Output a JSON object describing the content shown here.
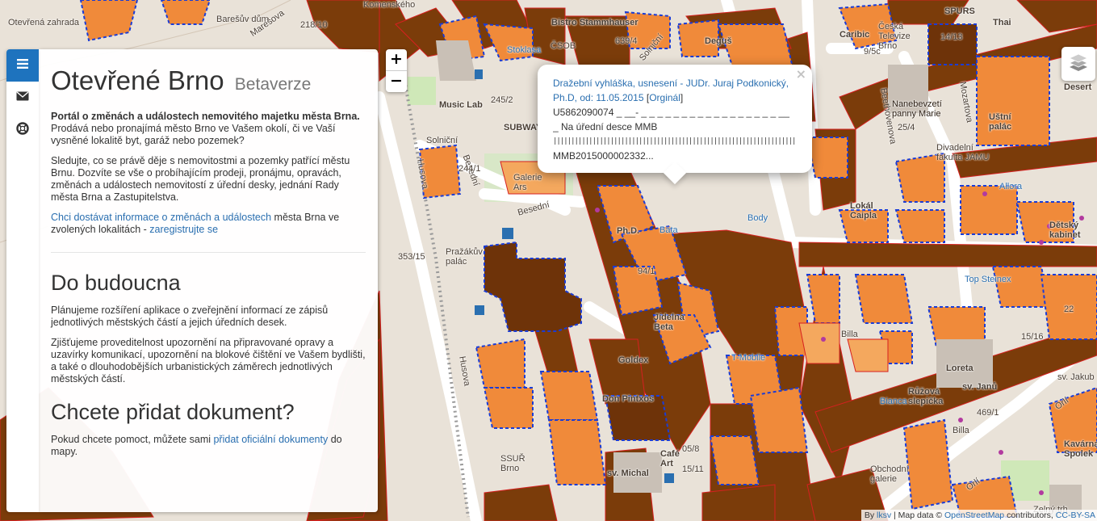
{
  "app": {
    "title": "Otevřené Brno",
    "subtitle": "Betaverze"
  },
  "rail": {
    "items": [
      {
        "icon": "menu-icon",
        "active": true
      },
      {
        "icon": "envelope-icon",
        "active": false
      },
      {
        "icon": "lifebuoy-icon",
        "active": false
      }
    ]
  },
  "intro": {
    "lead": "Portál o změnách a událostech nemovitého majetku města Brna.",
    "question": "Prodává nebo pronajímá město Brno ve Vašem okolí, či ve Vaší vysněné lokalitě byt, garáž nebo pozemek?",
    "paragraph": "Sledujte, co se právě děje s nemovitostmi a pozemky patřící městu Brnu. Dozvíte se vše o probíhajícím prodeji, pronájmu, opravách, změnách a událostech nemovitostí z úřední desky, jednání Rady města Brna a Zastupitelstva.",
    "subscribe_link": "Chci dostávat informace o změnách a událostech",
    "subscribe_mid": " města Brna ve zvolených lokalitách - ",
    "register_link": "zaregistrujte se"
  },
  "future": {
    "heading": "Do budoucna",
    "p1": "Plánujeme rozšíření aplikace o zveřejnění informací ze zápisů jednotlivých městských částí a jejich úředních desek.",
    "p2": "Zjišťujeme proveditelnost upozornění na připravované opravy a uzavírky komunikací, upozornění na blokové čištění ve Vašem bydlišti, a také o dlouhodobějších urbanistických záměrech jednotlivých městských částí."
  },
  "add_doc": {
    "heading": "Chcete přidat dokument?",
    "text_before": "Pokud chcete pomoct, můžete sami ",
    "link": "přidat oficiální dokumenty",
    "text_after": " do mapy."
  },
  "zoom": {
    "in": "+",
    "out": "−"
  },
  "popup": {
    "title_link": "Dražební vyhláška, usnesení - JUDr. Juraj Podkonický, Ph.D, od: 11.05.2015",
    "orig_open": " [",
    "orig_link": "Orginál",
    "orig_close": "]",
    "line1": "U5862090074 _ __- _ _ _ _ _ _ _ _ _ _ _ _ _ _ _ _ _ __",
    "line2": "_ Na úřední desce MMB",
    "line3": "||||||||||||||||||||||||||||||||||||||||||||||||||||||||||||||||||||||",
    "line4": "MMB2015000002332...",
    "close": "×"
  },
  "attribution": {
    "by": "By ",
    "author": "lksv",
    "map_data": " | Map data © ",
    "osm": "OpenStreetMap",
    "contrib": " contributors, ",
    "license": "CC-BY-SA"
  },
  "map_labels": [
    {
      "text": "Otevřená zahrada",
      "cls": ""
    },
    {
      "text": "Barešův dům",
      "cls": ""
    },
    {
      "text": "218/10",
      "cls": ""
    },
    {
      "text": "Marešova",
      "cls": "rot-a"
    },
    {
      "text": "Komenského",
      "cls": ""
    },
    {
      "text": "Bistro Stammhauser",
      "cls": "bold"
    },
    {
      "text": "639/4",
      "cls": ""
    },
    {
      "text": "Stoklasa",
      "cls": "blue"
    },
    {
      "text": "ČSOB",
      "cls": ""
    },
    {
      "text": "Solniční",
      "cls": "rot-e"
    },
    {
      "text": "Deguš",
      "cls": "bold"
    },
    {
      "text": "Caribic",
      "cls": "bold"
    },
    {
      "text": "Česká Televize Brno",
      "cls": ""
    },
    {
      "text": "9/5c",
      "cls": ""
    },
    {
      "text": "SPURS",
      "cls": "bold"
    },
    {
      "text": "Thai",
      "cls": "bold"
    },
    {
      "text": "14/13",
      "cls": ""
    },
    {
      "text": "Music Lab",
      "cls": "bold"
    },
    {
      "text": "245/2",
      "cls": ""
    },
    {
      "text": "SUBWAY",
      "cls": "bold"
    },
    {
      "text": "Solniční",
      "cls": ""
    },
    {
      "text": "Husova",
      "cls": "rot-b"
    },
    {
      "text": "Besední",
      "cls": "rot-d"
    },
    {
      "text": "Galerie Ars",
      "cls": ""
    },
    {
      "text": "Besední",
      "cls": "rot-c"
    },
    {
      "text": "244/1",
      "cls": ""
    },
    {
      "text": "Nanebevzetí panny Marie",
      "cls": "dark"
    },
    {
      "text": "Beethovenova",
      "cls": "rot-b"
    },
    {
      "text": "Mozartova",
      "cls": "rot-b"
    },
    {
      "text": "Uštní palác",
      "cls": "bold"
    },
    {
      "text": "25/4",
      "cls": ""
    },
    {
      "text": "Divadelní fakulta JAMU",
      "cls": ""
    },
    {
      "text": "Allora",
      "cls": "blue"
    },
    {
      "text": "Lokál Caipla",
      "cls": "bold"
    },
    {
      "text": "Dětský kabinet",
      "cls": "bold"
    },
    {
      "text": "353/15",
      "cls": ""
    },
    {
      "text": "Pražákův palác",
      "cls": ""
    },
    {
      "text": "Body",
      "cls": "blue"
    },
    {
      "text": "Bata",
      "cls": "blue"
    },
    {
      "text": "Ph.D.",
      "cls": "bold"
    },
    {
      "text": "94/1",
      "cls": ""
    },
    {
      "text": "Jídelna Beta",
      "cls": "bold"
    },
    {
      "text": "Top Steinex",
      "cls": "blue"
    },
    {
      "text": "Husova",
      "cls": "rot-b"
    },
    {
      "text": "Goldex",
      "cls": "bold"
    },
    {
      "text": "T-Mobile",
      "cls": "blue"
    },
    {
      "text": "Billa",
      "cls": ""
    },
    {
      "text": "15/16",
      "cls": ""
    },
    {
      "text": "Loreta",
      "cls": "bold"
    },
    {
      "text": "sv. Janů",
      "cls": "bold"
    },
    {
      "text": "Růžová slepička",
      "cls": "bold"
    },
    {
      "text": "Bianca",
      "cls": "blue"
    },
    {
      "text": "sv. Jakub",
      "cls": ""
    },
    {
      "text": "469/1",
      "cls": ""
    },
    {
      "text": "Don Pintxos",
      "cls": "bold"
    },
    {
      "text": "SSUŘ Brno",
      "cls": ""
    },
    {
      "text": "Café Art",
      "cls": "bold"
    },
    {
      "text": "sv. Michal",
      "cls": "bold"
    },
    {
      "text": "15/11",
      "cls": ""
    },
    {
      "text": "05/8",
      "cls": ""
    },
    {
      "text": "Obchodní galerie",
      "cls": ""
    },
    {
      "text": "Orlí",
      "cls": "rot-a"
    },
    {
      "text": "Orlí",
      "cls": "rot-a"
    },
    {
      "text": "Kavárna Spolek",
      "cls": "bold"
    },
    {
      "text": "Billa",
      "cls": ""
    },
    {
      "text": "Desert",
      "cls": "bold"
    },
    {
      "text": "22",
      "cls": ""
    },
    {
      "text": "Zelný trh",
      "cls": ""
    }
  ]
}
